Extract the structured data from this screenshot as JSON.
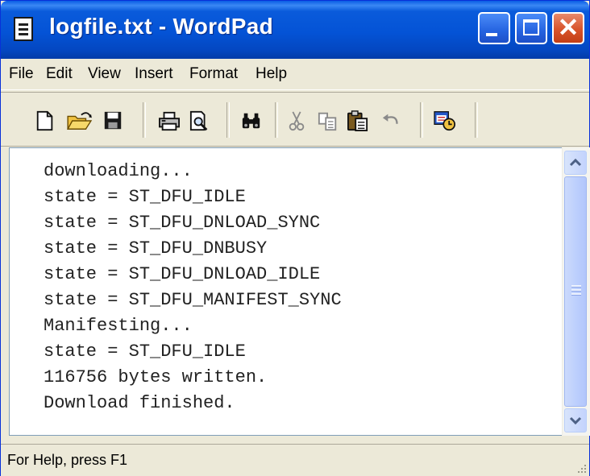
{
  "window": {
    "title": "logfile.txt - WordPad",
    "controls": {
      "minimize": "minimize",
      "maximize": "maximize",
      "close": "close"
    }
  },
  "menu": [
    "File",
    "Edit",
    "View",
    "Insert",
    "Format",
    "Help"
  ],
  "toolbar": {
    "buttons": [
      "new-document-icon",
      "open-folder-icon",
      "save-icon",
      "print-icon",
      "print-preview-icon",
      "find-icon",
      "cut-icon",
      "copy-icon",
      "paste-icon",
      "undo-icon",
      "insert-date-time-icon"
    ]
  },
  "document": {
    "lines": [
      "downloading...",
      "state = ST_DFU_IDLE",
      "state = ST_DFU_DNLOAD_SYNC",
      "state = ST_DFU_DNBUSY",
      "state = ST_DFU_DNLOAD_IDLE",
      "state = ST_DFU_MANIFEST_SYNC",
      "Manifesting...",
      "state = ST_DFU_IDLE",
      "116756 bytes written.",
      "Download finished."
    ]
  },
  "statusbar": {
    "text": "For Help, press F1"
  },
  "colors": {
    "title_bar": "#0453D6",
    "close_button": "#D8532A",
    "chrome": "#ECE9D8"
  }
}
